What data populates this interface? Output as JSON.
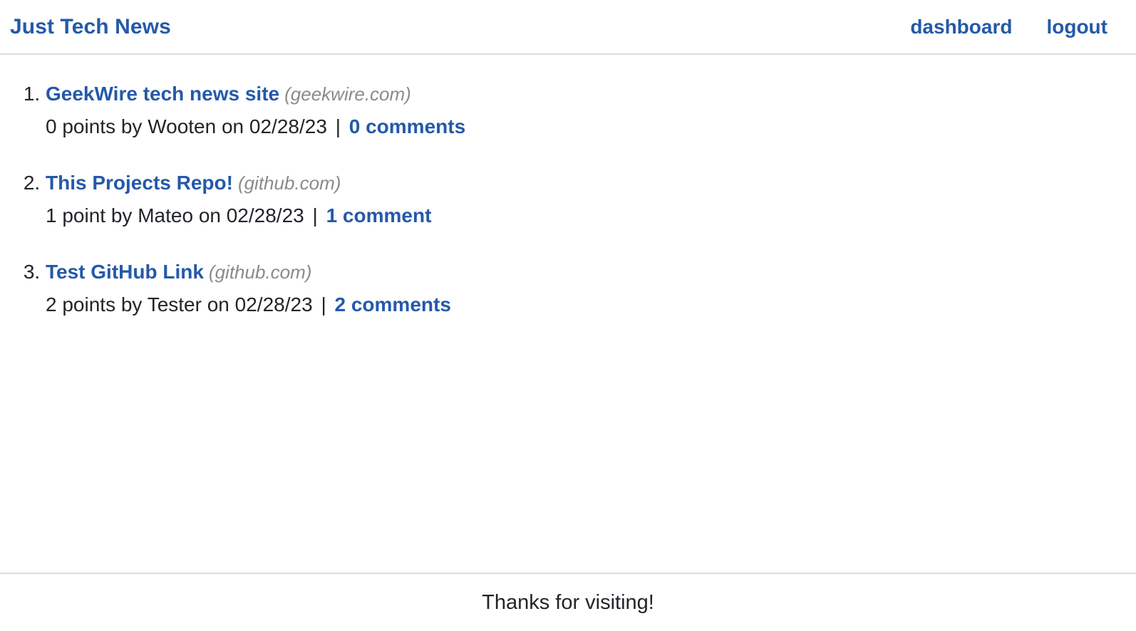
{
  "header": {
    "brand": "Just Tech News",
    "nav": [
      {
        "label": "dashboard",
        "name": "nav-link-dashboard"
      },
      {
        "label": "logout",
        "name": "nav-link-logout"
      }
    ]
  },
  "main": {
    "posts": [
      {
        "index": "1.",
        "title": "GeekWire tech news site",
        "domain": "(geekwire.com)",
        "points": "0 points",
        "by": "by Wooten",
        "on": "on 02/28/23",
        "separator": "|",
        "comments": "0 comments"
      },
      {
        "index": "2.",
        "title": "This Projects Repo!",
        "domain": "(github.com)",
        "points": "1 point",
        "by": "by Mateo",
        "on": "on 02/28/23",
        "separator": "|",
        "comments": "1 comment"
      },
      {
        "index": "3.",
        "title": "Test GitHub Link",
        "domain": "(github.com)",
        "points": "2 points",
        "by": "by Tester",
        "on": "on 02/28/23",
        "separator": "|",
        "comments": "2 comments"
      }
    ]
  },
  "footer": {
    "text": "Thanks for visiting!"
  },
  "colors": {
    "link": "#2459a9",
    "text": "#212529",
    "muted": "#8a8a8a",
    "border": "#dcdcde",
    "background": "#ffffff"
  }
}
